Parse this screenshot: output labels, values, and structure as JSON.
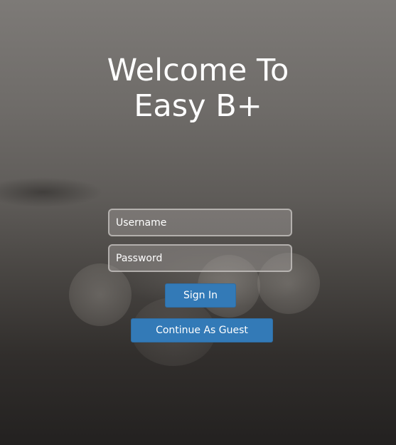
{
  "header": {
    "title_line1": "Welcome To",
    "title_line2": "Easy B+"
  },
  "login": {
    "username_placeholder": "Username",
    "username_value": "",
    "password_placeholder": "Password",
    "password_value": "",
    "signin_label": "Sign In",
    "guest_label": "Continue As Guest"
  },
  "colors": {
    "button_primary": "#337ab7",
    "text": "#ffffff"
  }
}
